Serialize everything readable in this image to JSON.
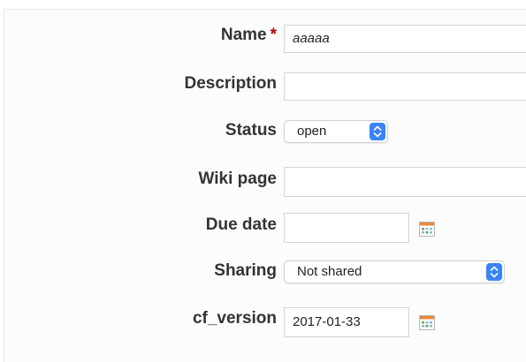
{
  "form": {
    "name": {
      "label": "Name",
      "required_mark": "*",
      "value": "aaaaa"
    },
    "description": {
      "label": "Description",
      "value": ""
    },
    "status": {
      "label": "Status",
      "selected": "open"
    },
    "wiki_page": {
      "label": "Wiki page",
      "value": ""
    },
    "due_date": {
      "label": "Due date",
      "value": ""
    },
    "sharing": {
      "label": "Sharing",
      "selected": "Not shared"
    },
    "cf_version": {
      "label": "cf_version",
      "value": "2017-01-33"
    }
  },
  "icons": {
    "calendar": "calendar-icon",
    "select_arrows": "updown-chevron-icon"
  },
  "colors": {
    "required": "#bb0000",
    "select_accent": "#3a83f7",
    "label_text": "#333333"
  }
}
